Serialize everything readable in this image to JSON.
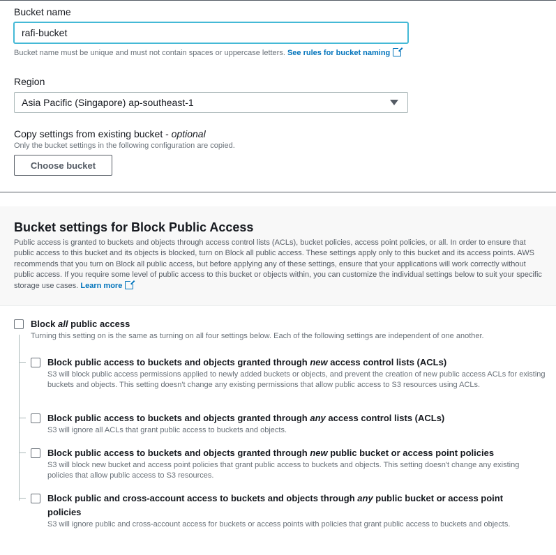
{
  "bucket_name": {
    "label": "Bucket name",
    "value": "rafi-bucket",
    "hint": "Bucket name must be unique and must not contain spaces or uppercase letters.",
    "link": "See rules for bucket naming"
  },
  "region": {
    "label": "Region",
    "selected": "Asia Pacific (Singapore) ap-southeast-1"
  },
  "copy_settings": {
    "label": "Copy settings from existing bucket - ",
    "label_optional": "optional",
    "hint": "Only the bucket settings in the following configuration are copied.",
    "button": "Choose bucket"
  },
  "block_public_access": {
    "title": "Bucket settings for Block Public Access",
    "description": "Public access is granted to buckets and objects through access control lists (ACLs), bucket policies, access point policies, or all. In order to ensure that public access to this bucket and its objects is blocked, turn on Block all public access. These settings apply only to this bucket and its access points. AWS recommends that you turn on Block all public access, but before applying any of these settings, ensure that your applications will work correctly without public access. If you require some level of public access to this bucket or objects within, you can customize the individual settings below to suit your specific storage use cases.",
    "learn_more": "Learn more",
    "block_all": {
      "title_pre": "Block ",
      "title_em": "all",
      "title_post": " public access",
      "desc": "Turning this setting on is the same as turning on all four settings below. Each of the following settings are independent of one another.",
      "checked": false
    },
    "options": [
      {
        "title_pre": "Block public access to buckets and objects granted through ",
        "title_em": "new",
        "title_post": " access control lists (ACLs)",
        "desc": "S3 will block public access permissions applied to newly added buckets or objects, and prevent the creation of new public access ACLs for existing buckets and objects. This setting doesn't change any existing permissions that allow public access to S3 resources using ACLs.",
        "checked": false
      },
      {
        "title_pre": "Block public access to buckets and objects granted through ",
        "title_em": "any",
        "title_post": " access control lists (ACLs)",
        "desc": "S3 will ignore all ACLs that grant public access to buckets and objects.",
        "checked": false
      },
      {
        "title_pre": "Block public access to buckets and objects granted through ",
        "title_em": "new",
        "title_post": " public bucket or access point policies",
        "desc": "S3 will block new bucket and access point policies that grant public access to buckets and objects. This setting doesn't change any existing policies that allow public access to S3 resources.",
        "checked": false
      },
      {
        "title_pre": "Block public and cross-account access to buckets and objects through ",
        "title_em": "any",
        "title_post": " public bucket or access point policies",
        "desc": "S3 will ignore public and cross-account access for buckets or access points with policies that grant public access to buckets and objects.",
        "checked": false
      }
    ]
  }
}
